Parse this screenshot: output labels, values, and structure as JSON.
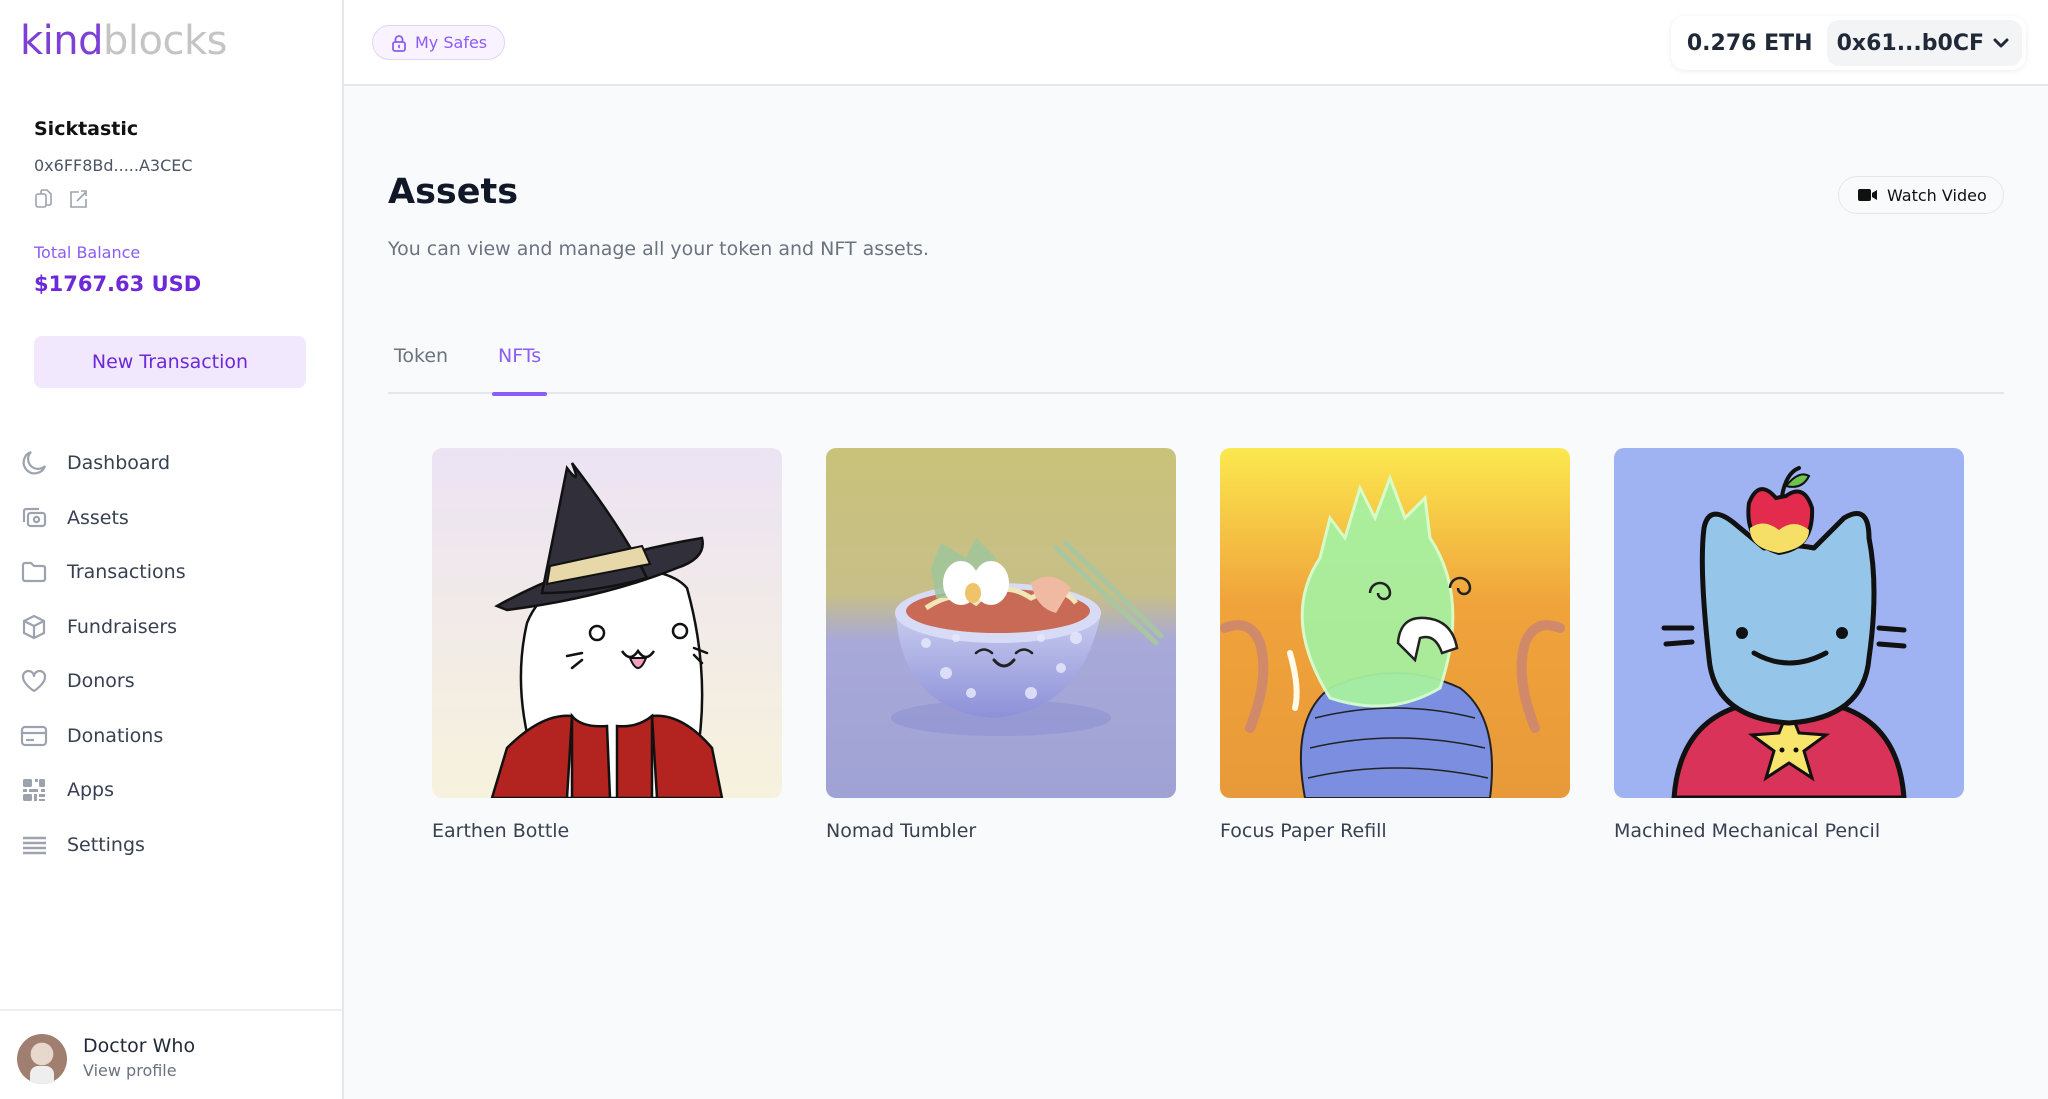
{
  "logo": {
    "part1": "kind",
    "part2": "blocks"
  },
  "safe": {
    "name": "Sicktastic",
    "address": "0x6FF8Bd.....A3CEC",
    "balance_label": "Total Balance",
    "balance_value": "$1767.63 USD"
  },
  "sidebar": {
    "new_transaction_label": "New Transaction",
    "items": [
      {
        "label": "Dashboard",
        "icon": "moon-icon"
      },
      {
        "label": "Assets",
        "icon": "assets-icon"
      },
      {
        "label": "Transactions",
        "icon": "folder-icon"
      },
      {
        "label": "Fundraisers",
        "icon": "cube-icon"
      },
      {
        "label": "Donors",
        "icon": "heart-icon"
      },
      {
        "label": "Donations",
        "icon": "card-icon"
      },
      {
        "label": "Apps",
        "icon": "qr-grid-icon"
      },
      {
        "label": "Settings",
        "icon": "menu-lines-icon"
      }
    ]
  },
  "profile": {
    "name": "Doctor Who",
    "link_label": "View profile"
  },
  "topbar": {
    "my_safes_label": "My Safes",
    "eth_balance": "0.276 ETH",
    "wallet_address": "0x61...b0CF"
  },
  "page": {
    "title": "Assets",
    "subtitle": "You can view and manage all your token and NFT assets.",
    "watch_video_label": "Watch Video",
    "tabs": [
      {
        "label": "Token",
        "active": false
      },
      {
        "label": "NFTs",
        "active": true
      }
    ]
  },
  "nfts": [
    {
      "name": "Earthen Bottle"
    },
    {
      "name": "Nomad Tumbler"
    },
    {
      "name": "Focus Paper Refill"
    },
    {
      "name": "Machined Mechanical Pencil"
    }
  ],
  "colors": {
    "accent": "#8b5cf6",
    "accent_dark": "#6d28d9",
    "accent_light_bg": "#f1e8fd"
  }
}
